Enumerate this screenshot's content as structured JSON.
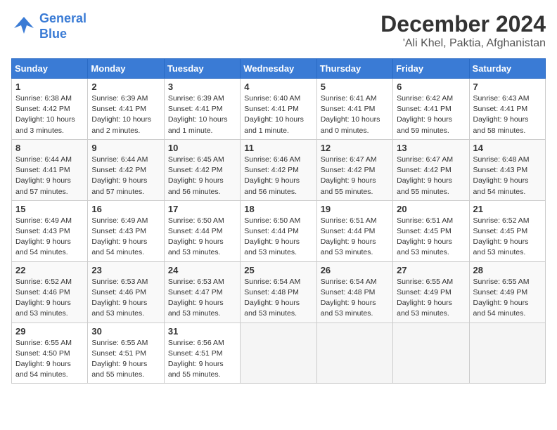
{
  "logo": {
    "line1": "General",
    "line2": "Blue"
  },
  "title": "December 2024",
  "location": "'Ali Khel, Paktia, Afghanistan",
  "days_of_week": [
    "Sunday",
    "Monday",
    "Tuesday",
    "Wednesday",
    "Thursday",
    "Friday",
    "Saturday"
  ],
  "weeks": [
    [
      {
        "day": 1,
        "info": "Sunrise: 6:38 AM\nSunset: 4:42 PM\nDaylight: 10 hours\nand 3 minutes."
      },
      {
        "day": 2,
        "info": "Sunrise: 6:39 AM\nSunset: 4:41 PM\nDaylight: 10 hours\nand 2 minutes."
      },
      {
        "day": 3,
        "info": "Sunrise: 6:39 AM\nSunset: 4:41 PM\nDaylight: 10 hours\nand 1 minute."
      },
      {
        "day": 4,
        "info": "Sunrise: 6:40 AM\nSunset: 4:41 PM\nDaylight: 10 hours\nand 1 minute."
      },
      {
        "day": 5,
        "info": "Sunrise: 6:41 AM\nSunset: 4:41 PM\nDaylight: 10 hours\nand 0 minutes."
      },
      {
        "day": 6,
        "info": "Sunrise: 6:42 AM\nSunset: 4:41 PM\nDaylight: 9 hours\nand 59 minutes."
      },
      {
        "day": 7,
        "info": "Sunrise: 6:43 AM\nSunset: 4:41 PM\nDaylight: 9 hours\nand 58 minutes."
      }
    ],
    [
      {
        "day": 8,
        "info": "Sunrise: 6:44 AM\nSunset: 4:41 PM\nDaylight: 9 hours\nand 57 minutes."
      },
      {
        "day": 9,
        "info": "Sunrise: 6:44 AM\nSunset: 4:42 PM\nDaylight: 9 hours\nand 57 minutes."
      },
      {
        "day": 10,
        "info": "Sunrise: 6:45 AM\nSunset: 4:42 PM\nDaylight: 9 hours\nand 56 minutes."
      },
      {
        "day": 11,
        "info": "Sunrise: 6:46 AM\nSunset: 4:42 PM\nDaylight: 9 hours\nand 56 minutes."
      },
      {
        "day": 12,
        "info": "Sunrise: 6:47 AM\nSunset: 4:42 PM\nDaylight: 9 hours\nand 55 minutes."
      },
      {
        "day": 13,
        "info": "Sunrise: 6:47 AM\nSunset: 4:42 PM\nDaylight: 9 hours\nand 55 minutes."
      },
      {
        "day": 14,
        "info": "Sunrise: 6:48 AM\nSunset: 4:43 PM\nDaylight: 9 hours\nand 54 minutes."
      }
    ],
    [
      {
        "day": 15,
        "info": "Sunrise: 6:49 AM\nSunset: 4:43 PM\nDaylight: 9 hours\nand 54 minutes."
      },
      {
        "day": 16,
        "info": "Sunrise: 6:49 AM\nSunset: 4:43 PM\nDaylight: 9 hours\nand 54 minutes."
      },
      {
        "day": 17,
        "info": "Sunrise: 6:50 AM\nSunset: 4:44 PM\nDaylight: 9 hours\nand 53 minutes."
      },
      {
        "day": 18,
        "info": "Sunrise: 6:50 AM\nSunset: 4:44 PM\nDaylight: 9 hours\nand 53 minutes."
      },
      {
        "day": 19,
        "info": "Sunrise: 6:51 AM\nSunset: 4:44 PM\nDaylight: 9 hours\nand 53 minutes."
      },
      {
        "day": 20,
        "info": "Sunrise: 6:51 AM\nSunset: 4:45 PM\nDaylight: 9 hours\nand 53 minutes."
      },
      {
        "day": 21,
        "info": "Sunrise: 6:52 AM\nSunset: 4:45 PM\nDaylight: 9 hours\nand 53 minutes."
      }
    ],
    [
      {
        "day": 22,
        "info": "Sunrise: 6:52 AM\nSunset: 4:46 PM\nDaylight: 9 hours\nand 53 minutes."
      },
      {
        "day": 23,
        "info": "Sunrise: 6:53 AM\nSunset: 4:46 PM\nDaylight: 9 hours\nand 53 minutes."
      },
      {
        "day": 24,
        "info": "Sunrise: 6:53 AM\nSunset: 4:47 PM\nDaylight: 9 hours\nand 53 minutes."
      },
      {
        "day": 25,
        "info": "Sunrise: 6:54 AM\nSunset: 4:48 PM\nDaylight: 9 hours\nand 53 minutes."
      },
      {
        "day": 26,
        "info": "Sunrise: 6:54 AM\nSunset: 4:48 PM\nDaylight: 9 hours\nand 53 minutes."
      },
      {
        "day": 27,
        "info": "Sunrise: 6:55 AM\nSunset: 4:49 PM\nDaylight: 9 hours\nand 53 minutes."
      },
      {
        "day": 28,
        "info": "Sunrise: 6:55 AM\nSunset: 4:49 PM\nDaylight: 9 hours\nand 54 minutes."
      }
    ],
    [
      {
        "day": 29,
        "info": "Sunrise: 6:55 AM\nSunset: 4:50 PM\nDaylight: 9 hours\nand 54 minutes."
      },
      {
        "day": 30,
        "info": "Sunrise: 6:55 AM\nSunset: 4:51 PM\nDaylight: 9 hours\nand 55 minutes."
      },
      {
        "day": 31,
        "info": "Sunrise: 6:56 AM\nSunset: 4:51 PM\nDaylight: 9 hours\nand 55 minutes."
      },
      null,
      null,
      null,
      null
    ]
  ]
}
